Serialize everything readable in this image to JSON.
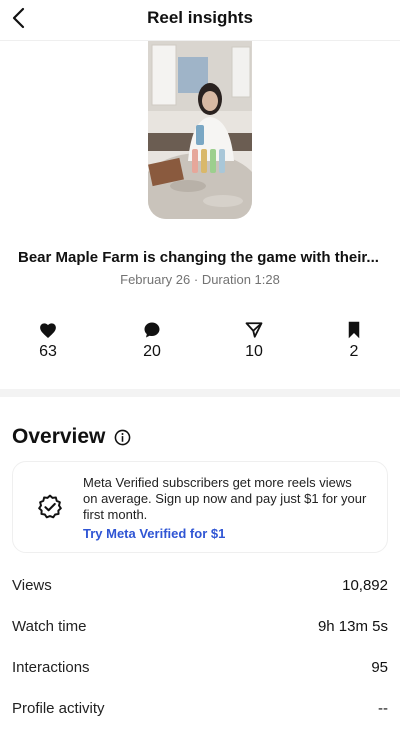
{
  "header": {
    "title": "Reel insights",
    "back_icon": "chevron-left-icon"
  },
  "reel": {
    "title": "Bear Maple Farm is changing the game with their...",
    "date": "February 26",
    "separator": "·",
    "duration": "Duration 1:28"
  },
  "stats": [
    {
      "icon": "heart-icon",
      "value": "63"
    },
    {
      "icon": "comment-icon",
      "value": "20"
    },
    {
      "icon": "share-icon",
      "value": "10"
    },
    {
      "icon": "bookmark-icon",
      "value": "2"
    }
  ],
  "overview": {
    "heading": "Overview",
    "promo": {
      "text": "Meta Verified subscribers get more reels views on average. Sign up now and pay just $1 for your first month.",
      "cta": "Try Meta Verified for $1",
      "cta_color": "#2f55d4"
    },
    "metrics": [
      {
        "label": "Views",
        "value": "10,892"
      },
      {
        "label": "Watch time",
        "value": "9h 13m 5s"
      },
      {
        "label": "Interactions",
        "value": "95"
      },
      {
        "label": "Profile activity",
        "value": "--"
      }
    ]
  }
}
